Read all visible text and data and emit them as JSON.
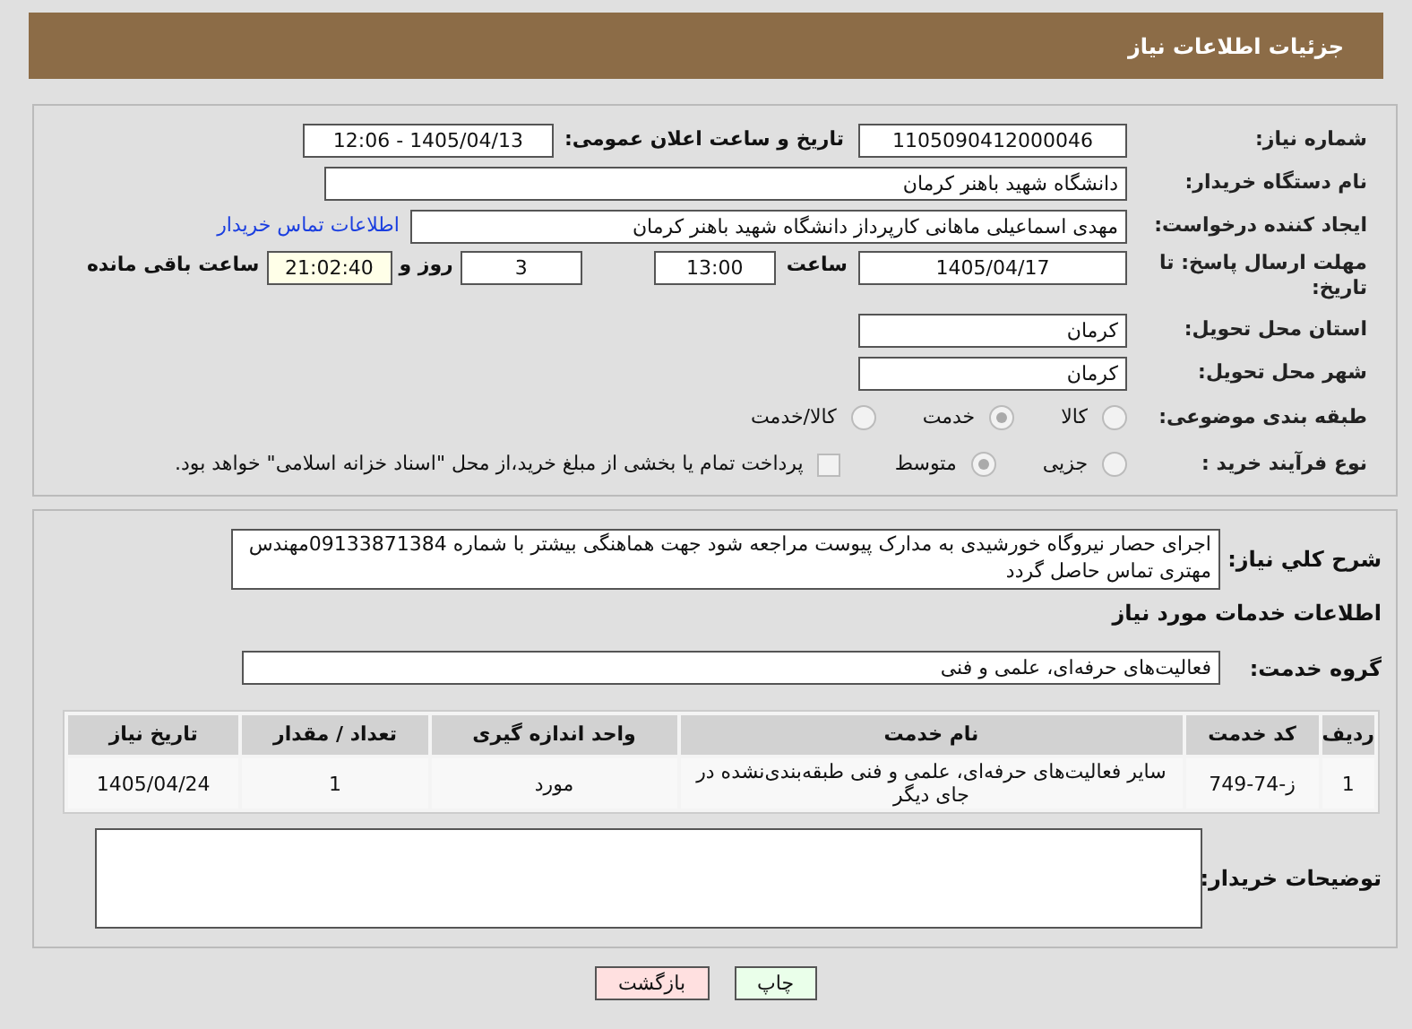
{
  "header": {
    "title": "جزئیات اطلاعات نیاز"
  },
  "need_number": {
    "label": "شماره نیاز:",
    "value": "1105090412000046"
  },
  "announce": {
    "label": "تاریخ و ساعت اعلان عمومی:",
    "value": "1405/04/13 - 12:06"
  },
  "buyer_org": {
    "label": "نام دستگاه خریدار:",
    "value": "دانشگاه شهید باهنر کرمان"
  },
  "requester": {
    "label": "ایجاد کننده درخواست:",
    "value": "مهدی اسماعیلی ماهانی  کارپرداز دانشگاه شهید باهنر کرمان",
    "link": "اطلاعات تماس خریدار"
  },
  "deadline": {
    "label": "مهلت ارسال پاسخ: تا تاریخ:",
    "date": "1405/04/17",
    "time_label": "ساعت",
    "time": "13:00",
    "days": "3",
    "days_label": "روز و",
    "remaining": "21:02:40",
    "remaining_label": "ساعت باقی مانده"
  },
  "province": {
    "label": "استان محل تحویل:",
    "value": "کرمان"
  },
  "city": {
    "label": "شهر محل تحویل:",
    "value": "کرمان"
  },
  "category": {
    "label": "طبقه بندی موضوعی:",
    "options": [
      {
        "label": "کالا",
        "selected": false
      },
      {
        "label": "خدمت",
        "selected": true
      },
      {
        "label": "کالا/خدمت",
        "selected": false
      }
    ]
  },
  "process": {
    "label": "نوع فرآیند خرید :",
    "options": [
      {
        "label": "جزیی",
        "selected": false
      },
      {
        "label": "متوسط",
        "selected": true
      }
    ],
    "payment": {
      "label": "پرداخت تمام یا بخشی از مبلغ خرید،از محل \"اسناد خزانه اسلامی\" خواهد بود.",
      "checked": false
    }
  },
  "summary": {
    "label": "شرح کلي نياز:",
    "value": "اجرای حصار نیروگاه خورشیدی به مدارک پیوست مراجعه شود جهت هماهنگی بیشتر با شماره 09133871384مهندس مهتری تماس حاصل گردد"
  },
  "services_title": "اطلاعات خدمات مورد نياز",
  "service_group": {
    "label": "گروه خدمت:",
    "value": "فعالیت‌های حرفه‌ای، علمی و فنی"
  },
  "table": {
    "columns": [
      "ردیف",
      "کد خدمت",
      "نام خدمت",
      "واحد اندازه گیری",
      "تعداد / مقدار",
      "تاریخ نیاز"
    ],
    "rows": [
      [
        "1",
        "ز-74-749",
        "سایر فعالیت‌های حرفه‌ای، علمی و فنی طبقه‌بندی‌نشده در جای دیگر",
        "مورد",
        "1",
        "1405/04/24"
      ]
    ]
  },
  "buyer_notes": {
    "label": "توضیحات خریدار:"
  },
  "buttons": [
    {
      "label": "چاپ",
      "kind": "print"
    },
    {
      "label": "بازگشت",
      "kind": "back"
    }
  ]
}
